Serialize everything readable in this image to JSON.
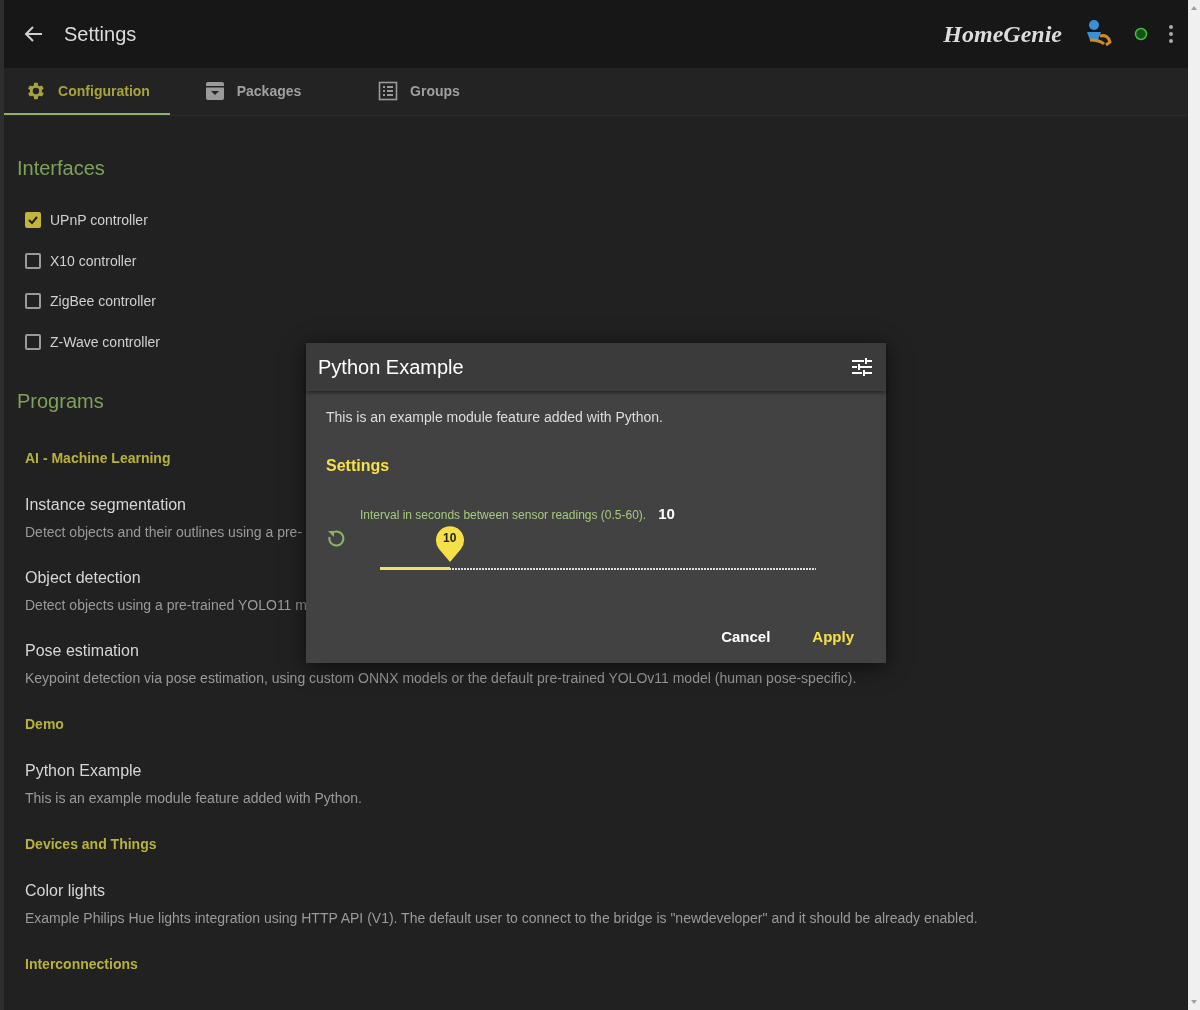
{
  "header": {
    "title": "Settings",
    "logo": "HomeGenie"
  },
  "tabs": [
    {
      "label": "Configuration",
      "selected": true
    },
    {
      "label": "Packages",
      "selected": false
    },
    {
      "label": "Groups",
      "selected": false
    }
  ],
  "interfaces": {
    "title": "Interfaces",
    "items": [
      {
        "label": "UPnP controller",
        "checked": true
      },
      {
        "label": "X10 controller",
        "checked": false
      },
      {
        "label": "ZigBee controller",
        "checked": false
      },
      {
        "label": "Z-Wave controller",
        "checked": false
      }
    ]
  },
  "programs": {
    "title": "Programs",
    "groups": [
      {
        "title": "AI - Machine Learning",
        "items": [
          {
            "name": "Instance segmentation",
            "description": "Detect objects and their outlines using a pre-"
          },
          {
            "name": "Object detection",
            "description": "Detect objects using a pre-trained YOLO11 m"
          },
          {
            "name": "Pose estimation",
            "description": "Keypoint detection via pose estimation, using custom ONNX models or the default pre-trained YOLOv11 model (human pose-specific)."
          }
        ]
      },
      {
        "title": "Demo",
        "items": [
          {
            "name": "Python Example",
            "description": "This is an example module feature added with Python."
          }
        ]
      },
      {
        "title": "Devices and Things",
        "items": [
          {
            "name": "Color lights",
            "description": "Example Philips Hue lights integration using HTTP API (V1). The default user to connect to the bridge is \"newdeveloper\" and it should be already enabled."
          }
        ]
      },
      {
        "title": "Interconnections"
      }
    ]
  },
  "dialog": {
    "title": "Python Example",
    "description": "This is an example module feature added with Python.",
    "section": "Settings",
    "setting": {
      "label": "Interval in seconds between sensor readings (0.5-60).",
      "value": "10",
      "bubble": "10",
      "level": 0.16
    },
    "buttons": [
      {
        "label": "Cancel",
        "kind": "secondary"
      },
      {
        "label": "Apply",
        "kind": "primary"
      }
    ]
  }
}
